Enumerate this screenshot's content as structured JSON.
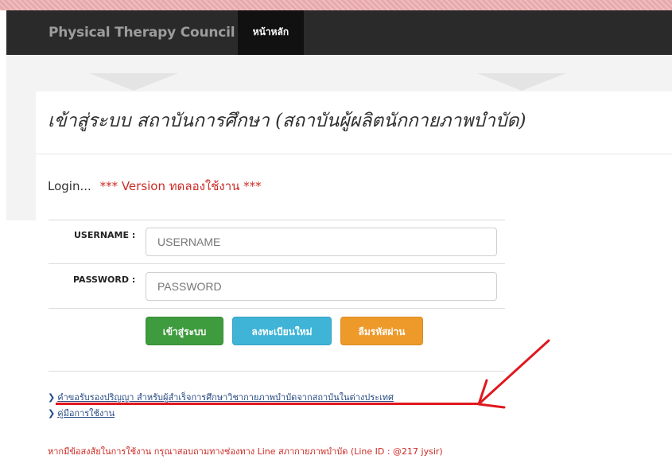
{
  "navbar": {
    "brand": "Physical Therapy Council",
    "home_tab": "หน้าหลัก"
  },
  "page": {
    "title": "เข้าสู่ระบบ สถาบันการศึกษา (สถาบันผู้ผลิตนักกายภาพบำบัด)",
    "login_label": "Login...",
    "version_note": "*** Version ทดลองใช้งาน ***"
  },
  "form": {
    "username_label": "USERNAME :",
    "username_placeholder": "USERNAME",
    "password_label": "PASSWORD :",
    "password_placeholder": "PASSWORD"
  },
  "buttons": {
    "login": "เข้าสู่ระบบ",
    "register": "ลงทะเบียนใหม่",
    "forgot": "ลืมรหัสผ่าน"
  },
  "links": [
    {
      "label": "คำขอรับรองปริญญา สำหรับผู้สำเร็จการศึกษาวิชากายภาพบำบัดจากสถาบันในต่างประเทศ"
    },
    {
      "label": "คู่มือการใช้งาน"
    }
  ],
  "footer_note": "หากมีข้อสงสัยในการใช้งาน กรุณาสอบถามทางช่องทาง Line สภากายภาพบำบัด (Line ID : @217 jysir)",
  "colors": {
    "navbar": "#2a2a2a",
    "accent_red": "#cc2b25",
    "login_button": "#3e9b3e",
    "register_button": "#3fb4d6",
    "forgot_button": "#ee9a2a",
    "annotation_red": "#e0181e"
  },
  "icons": {
    "link_bullet": "chevron-right-icon",
    "annotation": "red-arrow-annotation"
  }
}
